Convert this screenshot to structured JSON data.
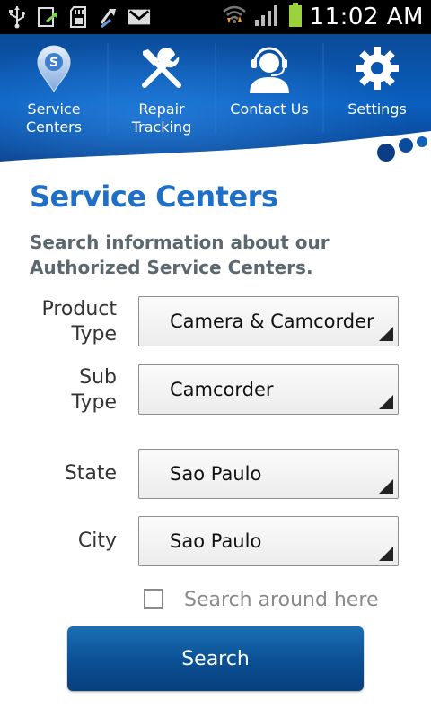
{
  "status_bar": {
    "time": "11:02 AM",
    "left_icons": [
      "usb-icon",
      "sync-icon",
      "sd-card-icon",
      "usb-debug-icon",
      "gmail-icon"
    ],
    "right_icons": [
      "wifi-icon",
      "signal-icon",
      "battery-icon"
    ]
  },
  "nav": {
    "items": [
      {
        "label": "Service Centers",
        "icon": "map-pin-icon"
      },
      {
        "label": "Repair Tracking",
        "icon": "tools-icon"
      },
      {
        "label": "Contact Us",
        "icon": "headset-icon"
      },
      {
        "label": "Settings",
        "icon": "gear-icon"
      }
    ]
  },
  "page": {
    "title": "Service Centers",
    "subtitle_line1": "Search information about our",
    "subtitle_line2": "Authorized Service Centers."
  },
  "form": {
    "product_type": {
      "label_line1": "Product",
      "label_line2": "Type",
      "value": "Camera & Camcorder"
    },
    "sub_type": {
      "label_line1": "Sub",
      "label_line2": "Type",
      "value": "Camcorder"
    },
    "state": {
      "label": "State",
      "value": "Sao Paulo"
    },
    "city": {
      "label": "City",
      "value": "Sao Paulo"
    },
    "search_around": {
      "label": "Search around here",
      "checked": false
    },
    "search_button": "Search"
  },
  "colors": {
    "title": "#1f6fc6",
    "banner": "#0a4a9a",
    "button": "#0b4f94"
  }
}
